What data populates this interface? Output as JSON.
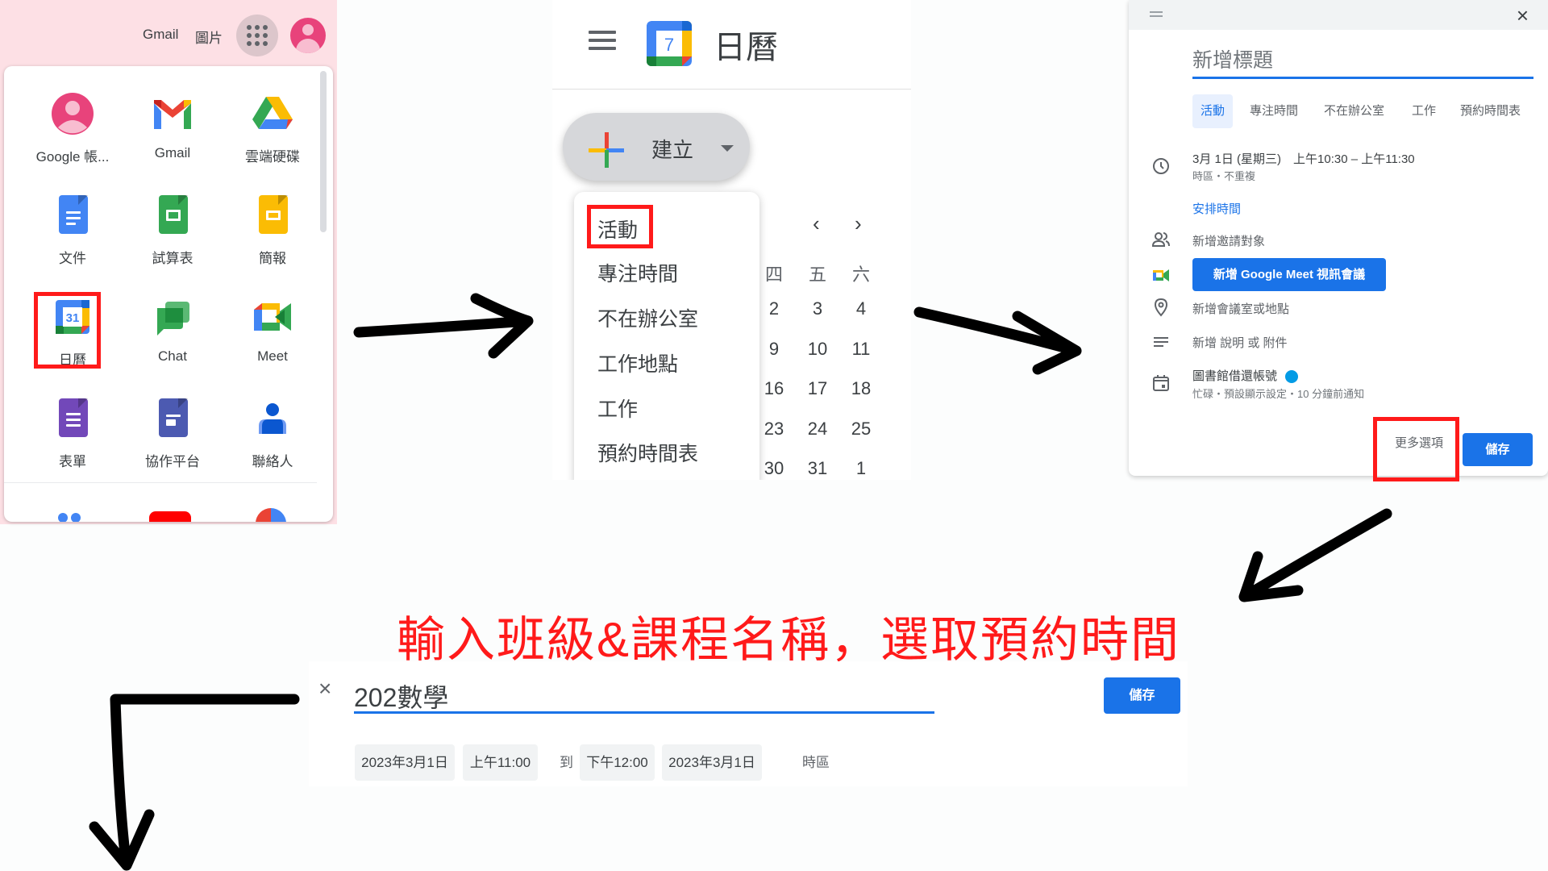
{
  "apps_launcher": {
    "top_links": [
      "Gmail",
      "圖片"
    ],
    "apps_button_icon": "apps-grid-icon",
    "avatar_icon": "account-avatar-icon",
    "apps": [
      {
        "label": "Google 帳...",
        "icon": "google-account-icon"
      },
      {
        "label": "Gmail",
        "icon": "gmail-icon"
      },
      {
        "label": "雲端硬碟",
        "icon": "drive-icon"
      },
      {
        "label": "文件",
        "icon": "docs-icon"
      },
      {
        "label": "試算表",
        "icon": "sheets-icon"
      },
      {
        "label": "簡報",
        "icon": "slides-icon"
      },
      {
        "label": "日曆",
        "icon": "calendar-icon",
        "highlighted": true,
        "badge": "31"
      },
      {
        "label": "Chat",
        "icon": "chat-icon"
      },
      {
        "label": "Meet",
        "icon": "meet-icon"
      },
      {
        "label": "表單",
        "icon": "forms-icon"
      },
      {
        "label": "協作平台",
        "icon": "sites-icon"
      },
      {
        "label": "聯絡人",
        "icon": "contacts-icon"
      }
    ]
  },
  "calendar": {
    "title": "日曆",
    "logo_day": "7",
    "create_label": "建立",
    "create_menu": [
      "活動",
      "專注時間",
      "不在辦公室",
      "工作地點",
      "工作",
      "預約時間表"
    ],
    "highlighted_menu_item": "活動",
    "nav_prev": "‹",
    "nav_next": "›",
    "weekday_headers": [
      "四",
      "五",
      "六"
    ],
    "month_rows": [
      [
        "2",
        "3",
        "4"
      ],
      [
        "9",
        "10",
        "11"
      ],
      [
        "16",
        "17",
        "18"
      ],
      [
        "23",
        "24",
        "25"
      ],
      [
        "30",
        "31",
        "1"
      ]
    ]
  },
  "quick_event": {
    "close_icon": "×",
    "title_placeholder": "新增標題",
    "type_tabs": [
      "活動",
      "專注時間",
      "不在辦公室",
      "工作",
      "預約時間表"
    ],
    "active_tab": "活動",
    "datetime": "3月 1日 (星期三)　上午10:30 – 上午11:30",
    "datetime_sub": "時區・不重複",
    "find_time_link": "安排時間",
    "add_guests": "新增邀請對象",
    "meet_button": "新增 Google Meet 視訊會議",
    "add_location": "新增會議室或地點",
    "add_description": "新增 說明 或 附件",
    "calendar_name": "圖書館借還帳號",
    "calendar_color": "#039be5",
    "calendar_sub": "忙碌・預設顯示設定・10 分鐘前通知",
    "more_options": "更多選項",
    "save": "儲存"
  },
  "caption": "輸入班級&課程名稱，選取預約時間",
  "event_editor": {
    "close_icon": "×",
    "title_value": "202數學",
    "save": "儲存",
    "start_date": "2023年3月1日",
    "start_time": "上午11:00",
    "to_label": "到",
    "end_time": "下午12:00",
    "end_date": "2023年3月1日",
    "timezone_label": "時區"
  },
  "colors": {
    "accent_blue": "#1a73e8",
    "highlight_red": "#ff1a1a",
    "launcher_bg": "#fde0e5"
  }
}
